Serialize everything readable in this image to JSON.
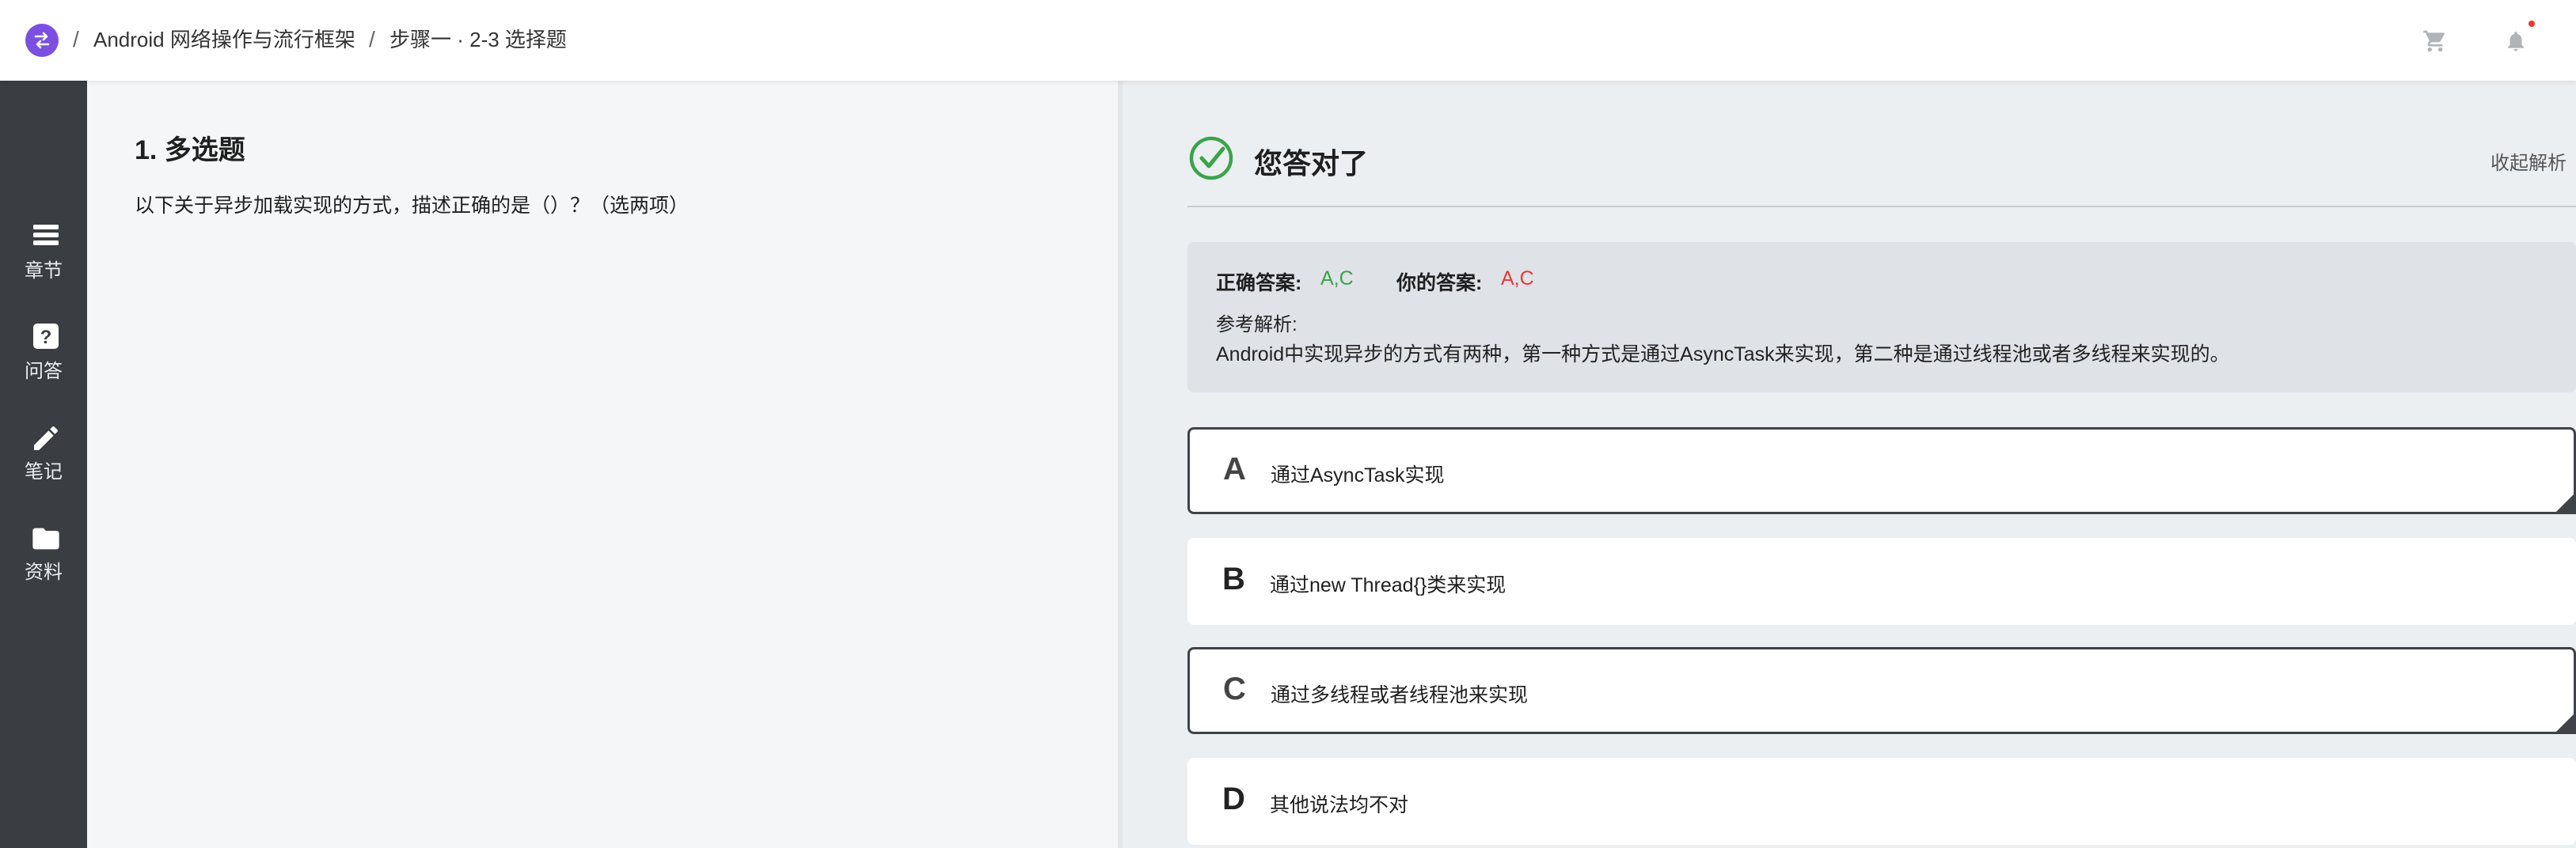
{
  "header": {
    "breadcrumb": {
      "course": "Android 网络操作与流行框架",
      "section": "步骤一 · 2-3 选择题",
      "separator": "/"
    },
    "icons": [
      "logo-icon",
      "cart-icon",
      "bell-icon"
    ]
  },
  "sidebar": {
    "items": [
      {
        "label": "章节",
        "icon": "chapter-icon"
      },
      {
        "label": "问答",
        "icon": "question-icon"
      },
      {
        "label": "笔记",
        "icon": "pencil-icon"
      },
      {
        "label": "资料",
        "icon": "folder-icon"
      }
    ]
  },
  "question": {
    "title": "1. 多选题",
    "text": "以下关于异步加载实现的方式，描述正确的是（）？（选两项）"
  },
  "result": {
    "title": "您答对了",
    "collapse_label": "收起解析",
    "correct_label": "正确答案:",
    "correct_value": "A,C",
    "yours_label": "你的答案:",
    "yours_value": "A,C",
    "reference_label": "参考解析:",
    "explanation": "Android中实现异步的方式有两种，第一种方式是通过AsyncTask来实现，第二种是通过线程池或者多线程来实现的。"
  },
  "options": [
    {
      "letter": "A",
      "text": "通过AsyncTask实现",
      "selected": true
    },
    {
      "letter": "B",
      "text": "通过new Thread{}类来实现",
      "selected": false
    },
    {
      "letter": "C",
      "text": "通过多线程或者线程池来实现",
      "selected": true
    },
    {
      "letter": "D",
      "text": "其他说法均不对",
      "selected": false
    }
  ],
  "colors": {
    "accent": "#7b4fe0",
    "correct": "#3aa34a",
    "wrong": "#e53935",
    "sidebar": "#3a3d42"
  }
}
